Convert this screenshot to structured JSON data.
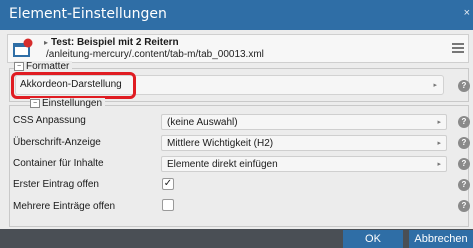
{
  "dialog": {
    "title": "Element-Einstellungen",
    "close_icon": "×"
  },
  "file": {
    "icon": "file-with-red-badge-icon",
    "name": "Test: Beispiel mit 2 Reitern",
    "path": "/anleitung-mercury/.content/tab-m/tab_00013.xml",
    "menu_icon": "hamburger-icon"
  },
  "sections": {
    "formatter": {
      "label": "Formatter",
      "toggle": "−"
    },
    "settings": {
      "label": "Einstellungen",
      "toggle": "−"
    }
  },
  "formatter": {
    "value": "Akkordeon-Darstellung",
    "highlight_color": "#e01c22"
  },
  "settings": {
    "rows": [
      {
        "label": "CSS Anpassung",
        "value": "(keine Auswahl)"
      },
      {
        "label": "Überschrift-Anzeige",
        "value": "Mittlere Wichtigkeit (H2)"
      },
      {
        "label": "Container für Inhalte",
        "value": "Elemente direkt einfügen"
      },
      {
        "label": "Erster Eintrag offen",
        "checked": true,
        "check_mark": "✓"
      },
      {
        "label": "Mehrere Einträge offen",
        "checked": false,
        "check_mark": ""
      }
    ]
  },
  "help_icon": "?",
  "arrow_icon": "▸",
  "buttons": {
    "ok": "OK",
    "cancel": "Abbrechen"
  },
  "colors": {
    "accent": "#2f6ea6",
    "background": "#ececec"
  }
}
